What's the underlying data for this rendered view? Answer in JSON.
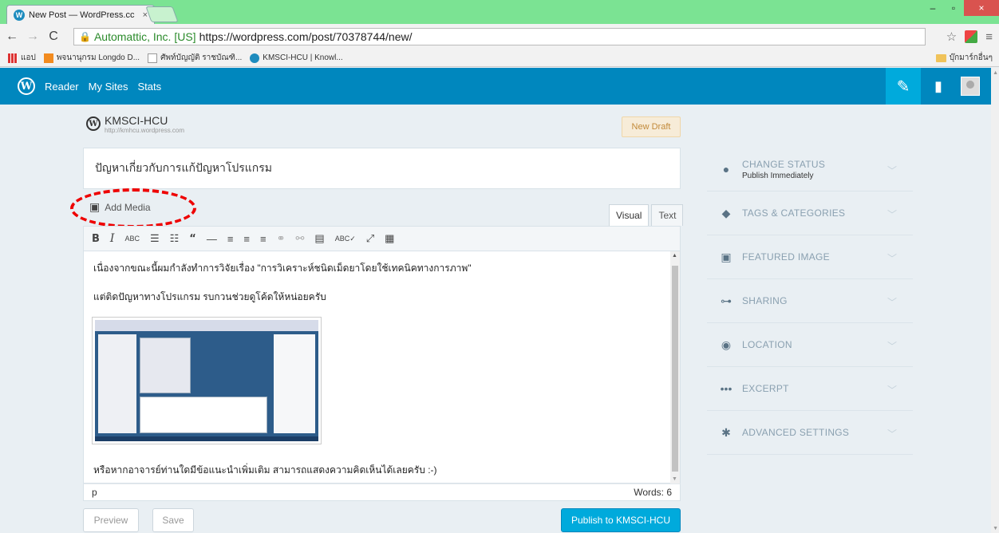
{
  "browser": {
    "tab_title": "New Post — WordPress.cc",
    "tab_close": "×",
    "ev_label": "Automattic, Inc. [US]",
    "url": "https://wordpress.com/post/70378744/new/",
    "win_min": "–",
    "win_max": "▫",
    "win_close": "×",
    "bookmarks": [
      {
        "label": "แอป",
        "icon": "apps-icon"
      },
      {
        "label": "พจนานุกรม Longdo D...",
        "icon": "longdo-icon"
      },
      {
        "label": "ศัพท์บัญญัติ ราชบัณฑิ...",
        "icon": "page-icon"
      },
      {
        "label": "KMSCI-HCU | Knowl...",
        "icon": "wordpress-icon"
      }
    ],
    "other_bookmarks": "บุ๊กมาร์กอื่นๆ"
  },
  "masterbar": {
    "logo_glyph": "W",
    "reader": "Reader",
    "my_sites": "My Sites",
    "stats": "Stats"
  },
  "site": {
    "name": "KMSCI-HCU",
    "url": "http://kmhcu.wordpress.com",
    "draft_badge": "New Draft"
  },
  "editor": {
    "title": "ปัญหาเกี่ยวกับการแก้ปัญหาโปรแกรม",
    "add_media": "Add Media",
    "tab_visual": "Visual",
    "tab_text": "Text",
    "paragraph1": "เนื่องจากขณะนี้ผมกำลังทำการวิจัยเรื่อง \"การวิเคราะห์ชนิดเม็ดยาโดยใช้เทคนิคทางการภาพ\"",
    "paragraph2": "แต่ติดปัญหาทางโปรแกรม รบกวนช่วยดูโค้ดให้หน่อยครับ",
    "paragraph3": "หรือหากอาจารย์ท่านใดมีข้อแนะนำเพิ่มเติม สามารถแสดงความคิดเห็นได้เลยครับ :-)",
    "path": "p",
    "word_count": "Words: 6",
    "preview": "Preview",
    "save": "Save",
    "publish": "Publish to KMSCI-HCU"
  },
  "sidebar": {
    "items": [
      {
        "label": "CHANGE STATUS",
        "sub": "Publish Immediately",
        "icon": "pin-icon"
      },
      {
        "label": "TAGS & CATEGORIES",
        "icon": "tag-icon"
      },
      {
        "label": "FEATURED IMAGE",
        "icon": "image-icon"
      },
      {
        "label": "SHARING",
        "icon": "share-icon"
      },
      {
        "label": "LOCATION",
        "icon": "location-icon"
      },
      {
        "label": "EXCERPT",
        "icon": "ellipsis-icon"
      },
      {
        "label": "ADVANCED SETTINGS",
        "icon": "gear-icon"
      }
    ]
  },
  "colors": {
    "masterbar": "#0087be",
    "publish": "#00aadc",
    "tab_strip": "#7be393",
    "annotation": "#ee0000"
  }
}
